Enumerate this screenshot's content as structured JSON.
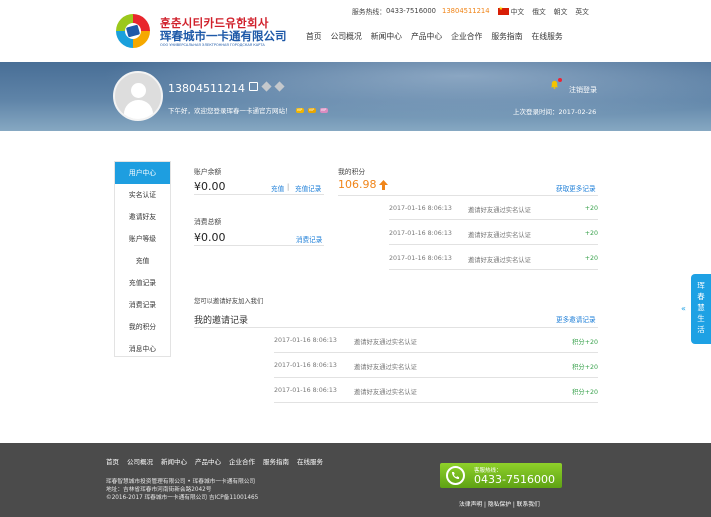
{
  "header": {
    "logo_kr": "훈춘시티카드유한회사",
    "logo_cn": "珲春城市一卡通有限公司",
    "logo_ru": "ООО УНИВЕРСАЛЬНАЯ ЭЛЕКТРОННАЯ ГОРОДСКАЯ КАРТА",
    "hotline_label": "服务热线：",
    "hotline_number": "0433-7516000",
    "hotline_mobile": "13804511214",
    "langs": [
      "中文",
      "俄文",
      "朝文",
      "英文"
    ],
    "nav": [
      "首页",
      "公司概况",
      "新闻中心",
      "产品中心",
      "企业合作",
      "服务指南",
      "在线服务"
    ]
  },
  "profile": {
    "phone": "13804511214",
    "welcome": "下午好，欢迎您登录珲春一卡通官方网站！",
    "badges": [
      "VIP",
      "VIP",
      "VIP"
    ],
    "logout": "注销登录",
    "last_login": "上次登录时间：2017-02-26"
  },
  "sidebar": {
    "items": [
      "用户中心",
      "实名认证",
      "邀请好友",
      "账户等级",
      "充值",
      "充值记录",
      "消费记录",
      "我的积分",
      "消息中心"
    ]
  },
  "account": {
    "balance_label": "账户余额",
    "balance": "¥0.00",
    "recharge": "充值",
    "separator": "|",
    "recharge_records": "充值记录",
    "consume_label": "消费总额",
    "consume": "¥0.00",
    "consume_records": "消费记录"
  },
  "points": {
    "label": "我的积分",
    "value": "106.98",
    "more": "获取更多记录",
    "rows": [
      {
        "time": "2017-01-16 8:06:13",
        "desc": "邀请好友通过实名认证",
        "pts": "+20"
      },
      {
        "time": "2017-01-16 8:06:13",
        "desc": "邀请好友通过实名认证",
        "pts": "+20"
      },
      {
        "time": "2017-01-16 8:06:13",
        "desc": "邀请好友通过实名认证",
        "pts": "+20"
      }
    ]
  },
  "invite": {
    "hint": "您可以邀请好友加入我们",
    "title": "我的邀请记录",
    "more": "更多邀请记录",
    "rows": [
      {
        "time": "2017-01-16 8:06:13",
        "desc": "邀请好友通过实名认证",
        "pts": "积分+20"
      },
      {
        "time": "2017-01-16 8:06:13",
        "desc": "邀请好友通过实名认证",
        "pts": "积分+20"
      },
      {
        "time": "2017-01-16 8:06:13",
        "desc": "邀请好友通过实名认证",
        "pts": "积分+20"
      }
    ]
  },
  "sidetab": {
    "text": "珲春慧生活",
    "arrow": "«"
  },
  "footer": {
    "nav": [
      "首页",
      "公司概况",
      "新闻中心",
      "产品中心",
      "企业合作",
      "服务指南",
      "在线服务"
    ],
    "line1": "珲春智慧城市投资管理有限公司 • 珲春城市一卡通有限公司",
    "line2": "地址：吉林省珲春市河南街新会路2042号",
    "line3": "©2016-2017 珲春城市一卡通有限公司 吉ICP备11001465",
    "hotline_label": "客服热线：",
    "hotline_number": "0433-7516000",
    "links": "法律声明 | 隐私保护 | 联系我们"
  },
  "colors": {
    "accent_blue": "#1e9ee0",
    "orange": "#f08519",
    "green": "#37a14b"
  }
}
